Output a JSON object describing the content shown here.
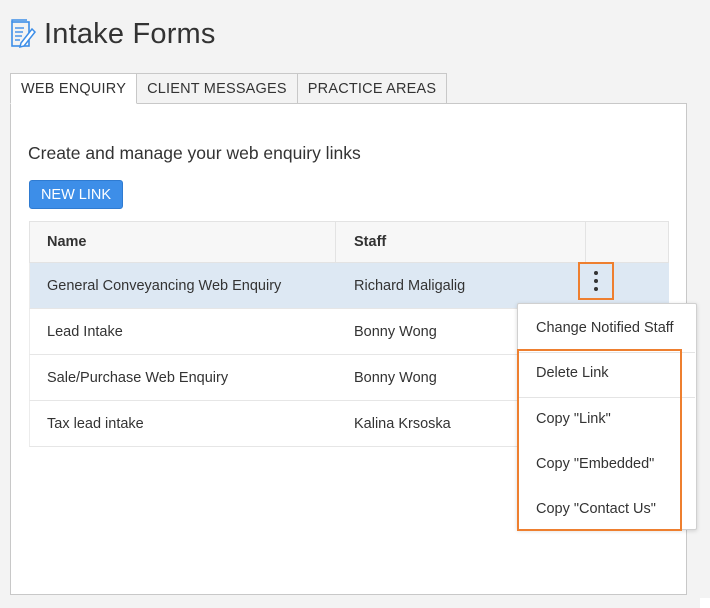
{
  "page": {
    "title": "Intake Forms",
    "icon": "form-edit-icon"
  },
  "tabs": [
    {
      "label": "WEB ENQUIRY",
      "active": true
    },
    {
      "label": "CLIENT MESSAGES",
      "active": false
    },
    {
      "label": "PRACTICE AREAS",
      "active": false
    }
  ],
  "content": {
    "intro": "Create and manage your web enquiry links",
    "new_link_label": "NEW LINK"
  },
  "table": {
    "headers": {
      "name": "Name",
      "staff": "Staff"
    },
    "rows": [
      {
        "name": "General Conveyancing Web Enquiry",
        "staff": "Richard Maligalig",
        "selected": true
      },
      {
        "name": "Lead Intake",
        "staff": "Bonny Wong",
        "selected": false
      },
      {
        "name": "Sale/Purchase Web Enquiry",
        "staff": "Bonny Wong",
        "selected": false
      },
      {
        "name": "Tax lead intake",
        "staff": "Kalina Krsoska",
        "selected": false
      }
    ]
  },
  "context_menu": {
    "items": [
      "Change Notified Staff",
      "Delete Link",
      "Copy \"Link\"",
      "Copy \"Embedded\"",
      "Copy \"Contact Us\""
    ]
  },
  "colors": {
    "accent": "#3d8ee8",
    "highlight": "#ee7f2f",
    "selected_row": "#dde8f3"
  }
}
